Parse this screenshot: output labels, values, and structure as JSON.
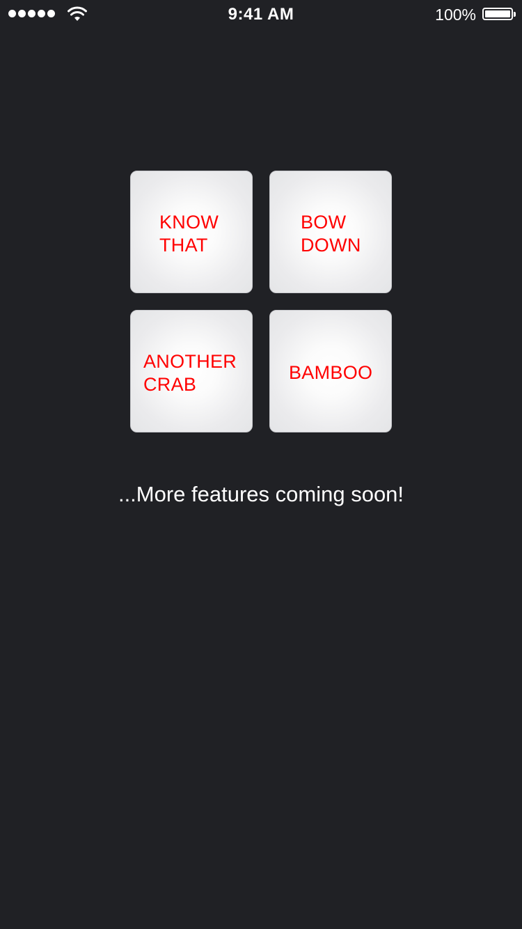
{
  "status_bar": {
    "signal_icon": "cellular-signal-icon",
    "wifi_icon": "wifi-icon",
    "time": "9:41 AM",
    "battery_percent": "100%",
    "battery_icon": "battery-icon",
    "battery_level": 1.0
  },
  "colors": {
    "background": "#202125",
    "tile_label": "#ff0000",
    "tile_face": "#f0f0f2",
    "text": "#ffffff"
  },
  "tiles": [
    {
      "label": "KNOW\nTHAT"
    },
    {
      "label": "BOW\nDOWN"
    },
    {
      "label": "ANOTHER\nCRAB"
    },
    {
      "label": "BAMBOO"
    }
  ],
  "footer": {
    "message": "...More features coming soon!"
  }
}
